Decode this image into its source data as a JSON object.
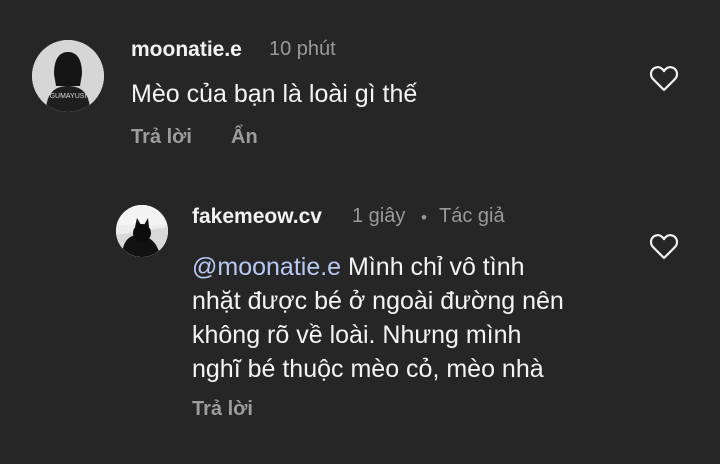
{
  "comments": [
    {
      "username": "moonatie.e",
      "time": "10 phút",
      "avatar_label": "GUMAYUSI",
      "text": "Mèo của bạn là loài gì thế",
      "actions": {
        "reply": "Trả lời",
        "hide": "Ẩn"
      },
      "like_icon": "heart-outline-icon"
    }
  ],
  "reply": {
    "username": "fakemeow.cv",
    "time": "1 giây",
    "separator": "•",
    "author_badge": "Tác giả",
    "mention": "@moonatie.e",
    "text_lines": [
      "Mình chỉ vô tình",
      "nhặt được bé ở ngoài đường nên",
      "không rõ về loài. Nhưng mình",
      "nghĩ bé thuộc mèo cỏ, mèo nhà"
    ],
    "actions": {
      "reply": "Trả lời"
    },
    "like_icon": "heart-outline-icon"
  },
  "colors": {
    "background": "#262626",
    "text": "#f4f4f4",
    "muted": "#9a9a9a",
    "mention": "#b7c9f3"
  }
}
